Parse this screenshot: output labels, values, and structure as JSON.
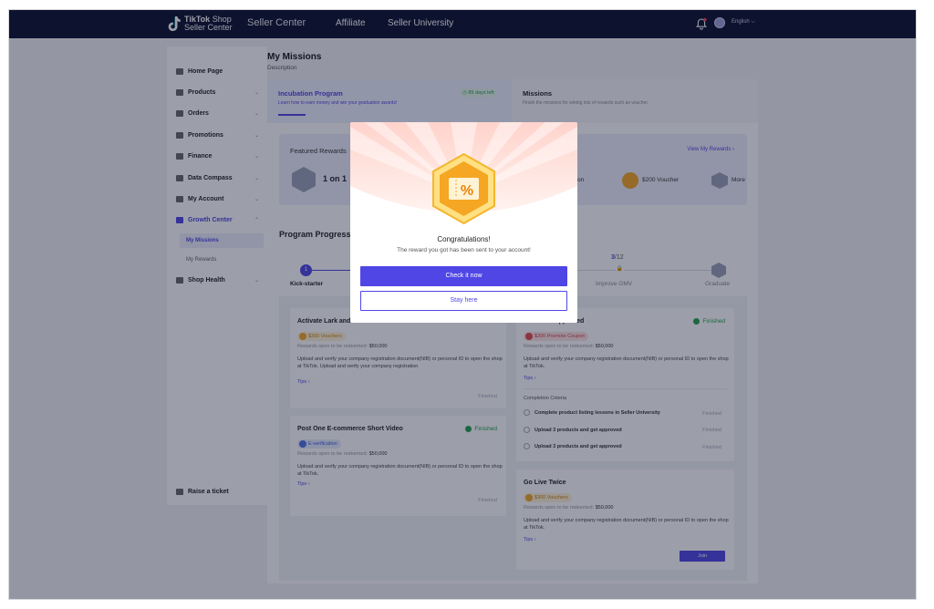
{
  "topbar": {
    "logo_line1": "TikTok",
    "logo_line1_suffix": "Shop",
    "logo_line2": "Seller Center",
    "nav_seller_center": "Seller Center",
    "nav_affiliate": "Affiliate",
    "nav_university": "Seller University",
    "language": "English ⌵"
  },
  "sidebar": {
    "items": [
      {
        "label": "Home Page",
        "icon": "home-icon"
      },
      {
        "label": "Products",
        "icon": "box-icon"
      },
      {
        "label": "Orders",
        "icon": "orders-icon"
      },
      {
        "label": "Promotions",
        "icon": "megaphone-icon"
      },
      {
        "label": "Finance",
        "icon": "wallet-icon"
      },
      {
        "label": "Data Compass",
        "icon": "chart-icon"
      },
      {
        "label": "My Account",
        "icon": "user-icon"
      },
      {
        "label": "Growth Center",
        "icon": "growth-icon"
      },
      {
        "label": "Shop Health",
        "icon": "heart-icon"
      }
    ],
    "sub_items": [
      "My Missions",
      "My Rewards"
    ],
    "raise_ticket": "Raise a ticket"
  },
  "main": {
    "title": "My Missions",
    "description": "Description",
    "incubation": {
      "title": "Incubation Program",
      "subtitle": "Learn how to earn money and win your graduation awards!",
      "days_left": "89 days left"
    },
    "missions_tab": {
      "title": "Missions",
      "subtitle": "Finish the missions for wining lots of rewards such as voucher."
    },
    "featured": {
      "title": "Featured Rewards",
      "view_all": "View My Rewards  ›",
      "item1": "1 on 1",
      "item2_tail": "on",
      "item3": "$200 Voucher",
      "item4": "More"
    },
    "progress": {
      "title": "Program Progress",
      "step1_num": "1",
      "step1_label": "Kick-starter",
      "count_done": "3",
      "count_total": "/12",
      "step_gmv": "Improve GMV",
      "step_grad": "Graduate"
    },
    "tasks": {
      "t1": {
        "title": "Activate Lark and",
        "badge": "$300 Vouchers",
        "rewards_label": "Rewards open to be redeemed:",
        "rewards_value": "$50,000",
        "desc": "Upload and verify your company registration document(NIB) or personal ID to open the shop at TikTok. Upload and verify your company registration",
        "tips": "Tips  ›",
        "finished_mini": "Finished"
      },
      "t2": {
        "title": "s and Get Approved",
        "status": "Finished",
        "badge": "$300 Promote Coupon",
        "rewards_label": "Rewards open to be redeemed:",
        "rewards_value": "$50,000",
        "desc": "Upload and verify your company registration document(NIB) or personal ID to open the shop at TikTok.",
        "tips": "Tips  ›",
        "criteria_title": "Completion Criteria",
        "criteria": [
          {
            "label": "Complete product listing lessons in Seller University",
            "status": "Finished"
          },
          {
            "label": "Upload 3 products and get approved",
            "status": "Finished"
          },
          {
            "label": "Upload 3 products and get approved",
            "status": "Finished"
          }
        ]
      },
      "t3": {
        "title": "Post One E-commerce Short Video",
        "status": "Finished",
        "badge": "E-verification",
        "rewards_label": "Rewards open to be redeemed:",
        "rewards_value": "$50,000",
        "desc": "Upload and verify your company registration document(NIB) or personal ID to open the shop at TikTok.",
        "tips": "Tips  ›",
        "finished_mini": "Finished"
      },
      "t4": {
        "title": "Go Live Twice",
        "badge": "$300 Vouchers",
        "rewards_label": "Rewards open to be redeemed:",
        "rewards_value": "$50,000",
        "desc": "Upload and verify your company registration document(NIB) or personal ID to open the shop at TikTok.",
        "tips": "Tips  ›",
        "join": "Join"
      }
    }
  },
  "modal": {
    "title": "Congratulations!",
    "message": "The reward you got has been sent to your account!",
    "primary": "Check it now",
    "secondary": "Stay here",
    "badge_symbol": "%"
  },
  "colors": {
    "brand": "#4f46e5",
    "topbar": "#0a0f2c",
    "success": "#22a34a",
    "gold": "#f5a623"
  }
}
